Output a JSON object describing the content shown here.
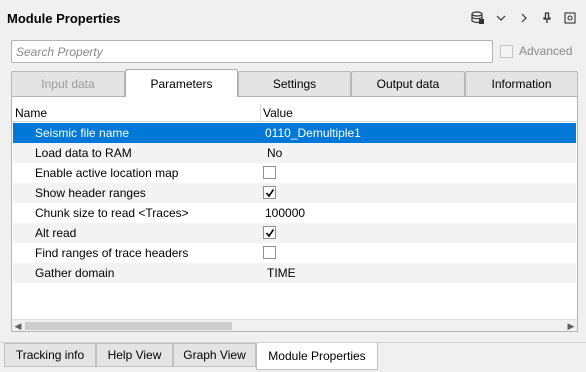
{
  "window": {
    "title": "Module Properties",
    "icons": [
      "database-icon",
      "chevron-down-icon",
      "chevron-right-icon",
      "pin-icon",
      "settings-icon"
    ]
  },
  "search": {
    "placeholder": "Search Property"
  },
  "advanced": {
    "label": "Advanced",
    "checked": false
  },
  "tabs": [
    {
      "label": "Input data",
      "state": "disabled"
    },
    {
      "label": "Parameters",
      "state": "active"
    },
    {
      "label": "Settings",
      "state": "normal"
    },
    {
      "label": "Output data",
      "state": "normal"
    },
    {
      "label": "Information",
      "state": "normal"
    }
  ],
  "table": {
    "columns": [
      "Name",
      "Value"
    ],
    "rows": [
      {
        "name": "Seismic file name",
        "value": "0110_Demultiple1",
        "type": "text",
        "selected": true
      },
      {
        "name": "Load data to RAM",
        "value": "No",
        "type": "text"
      },
      {
        "name": "Enable active location map",
        "value": "",
        "type": "checkbox",
        "checked": false
      },
      {
        "name": "Show header ranges",
        "value": "",
        "type": "checkbox",
        "checked": true
      },
      {
        "name": "Chunk size to read <Traces>",
        "value": "100000",
        "type": "text"
      },
      {
        "name": "Alt read",
        "value": "",
        "type": "checkbox",
        "checked": true
      },
      {
        "name": "Find ranges of trace headers",
        "value": "",
        "type": "checkbox",
        "checked": false
      },
      {
        "name": "Gather domain",
        "value": "TIME",
        "type": "text"
      }
    ]
  },
  "bottom_tabs": [
    {
      "label": "Tracking info",
      "active": false
    },
    {
      "label": "Help View",
      "active": false
    },
    {
      "label": "Graph View",
      "active": false
    },
    {
      "label": "Module Properties",
      "active": true
    }
  ],
  "colors": {
    "selection": "#0078d7",
    "alt_row": "#f3f3f3"
  }
}
